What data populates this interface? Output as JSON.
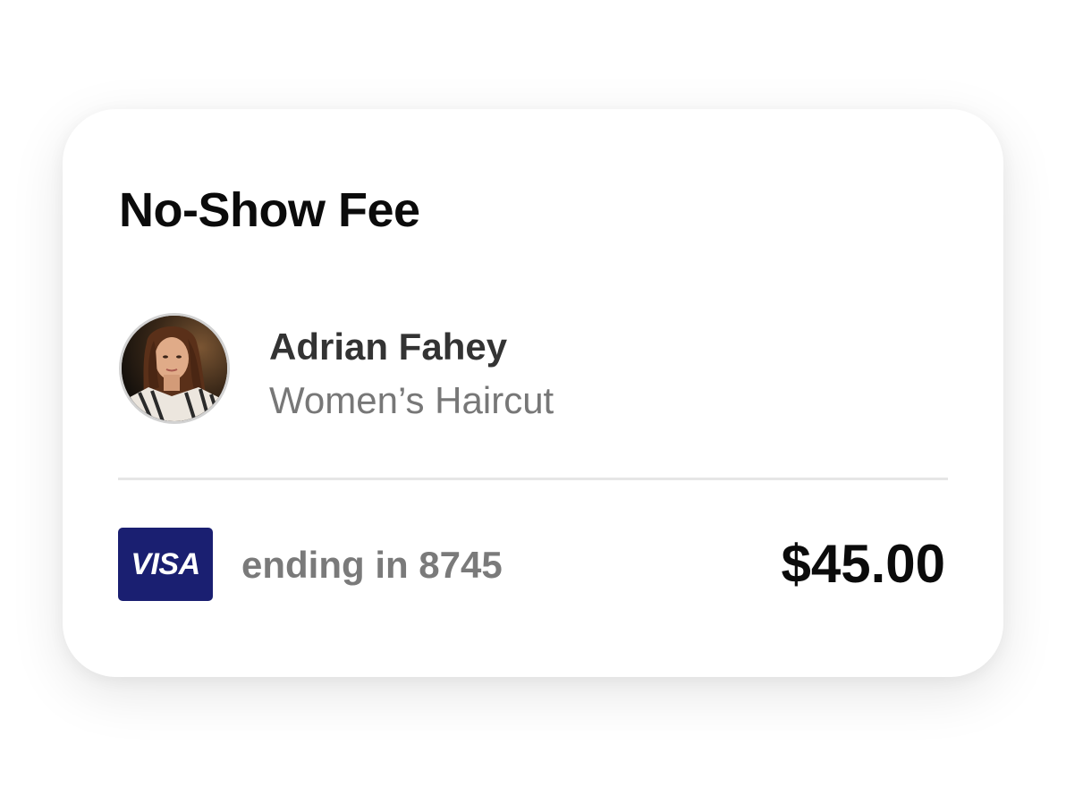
{
  "card": {
    "title": "No-Show Fee"
  },
  "client": {
    "name": "Adrian Fahey",
    "service": "Women’s Haircut",
    "avatar": "woman-portrait-photo"
  },
  "payment": {
    "brand": "VISA",
    "ending_text": "ending in 8745",
    "amount": "$45.00"
  },
  "colors": {
    "visa_blue": "#1a1f71",
    "title_text": "#0b0b0b",
    "muted_text": "#777777",
    "divider": "#e6e6e6"
  }
}
